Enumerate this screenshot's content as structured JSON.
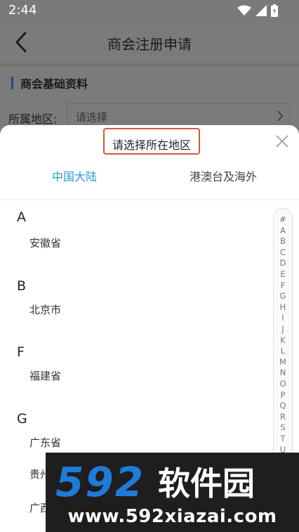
{
  "status_bar": {
    "time": "2:44"
  },
  "app_bar": {
    "title": "商会注册申请"
  },
  "section": {
    "title": "商会基础资料"
  },
  "form": {
    "region_label": "所属地区:",
    "region_placeholder": "请选择"
  },
  "sheet": {
    "title": "请选择所在地区",
    "tabs": [
      {
        "label": "中国大陆",
        "active": true
      },
      {
        "label": "港澳台及海外",
        "active": false
      }
    ],
    "groups": [
      {
        "letter": "A",
        "items": [
          "安徽省"
        ]
      },
      {
        "letter": "B",
        "items": [
          "北京市"
        ]
      },
      {
        "letter": "F",
        "items": [
          "福建省"
        ]
      },
      {
        "letter": "G",
        "items": [
          "广东省",
          "贵州省",
          "广西壮族自治区"
        ]
      }
    ],
    "index_letters": [
      "#",
      "A",
      "B",
      "C",
      "D",
      "E",
      "F",
      "G",
      "H",
      "I",
      "J",
      "K",
      "L",
      "M",
      "N",
      "O",
      "P",
      "Q",
      "R",
      "S",
      "T",
      "U"
    ]
  },
  "watermark": {
    "logo_text": "592软件园",
    "url": "www.592xiazai.com"
  },
  "colors": {
    "accent_tab": "#2b98c9",
    "highlight_border": "#d45a3c",
    "section_bar": "#1e4c78",
    "watermark_blue": "#1f7bd8"
  }
}
